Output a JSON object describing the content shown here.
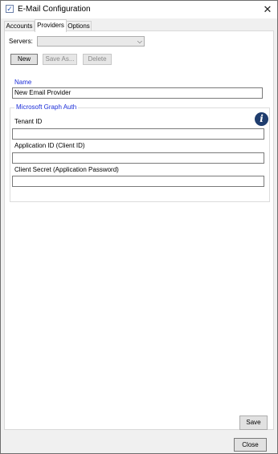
{
  "window": {
    "title": "E-Mail Configuration",
    "close_glyph": "✕",
    "app_icon": "checkbox-icon",
    "app_icon_glyph": "✓"
  },
  "tabs": [
    {
      "label": "Accounts",
      "active": false
    },
    {
      "label": "Providers",
      "active": true
    },
    {
      "label": "Options",
      "active": false
    }
  ],
  "providers": {
    "servers_label": "Servers:",
    "servers_value": "",
    "buttons": {
      "new": "New",
      "save_as": "Save As...",
      "delete": "Delete"
    },
    "name_label": "Name",
    "name_value": "New Email Provider",
    "auth_group": {
      "title": "Microsoft Graph Auth",
      "info_icon": "info-icon",
      "info_glyph": "i",
      "tenant_id_label": "Tenant ID",
      "tenant_id_value": "",
      "application_id_label": "Application ID (Client ID)",
      "application_id_value": "",
      "client_secret_label": "Client Secret (Application Password)",
      "client_secret_value": ""
    },
    "save_label": "Save"
  },
  "footer": {
    "close_label": "Close"
  },
  "colors": {
    "accent_label": "#1a2cd8",
    "info_icon_bg": "#1f3d6e",
    "window_bg": "#f0f0f0",
    "panel_bg": "#ffffff"
  }
}
